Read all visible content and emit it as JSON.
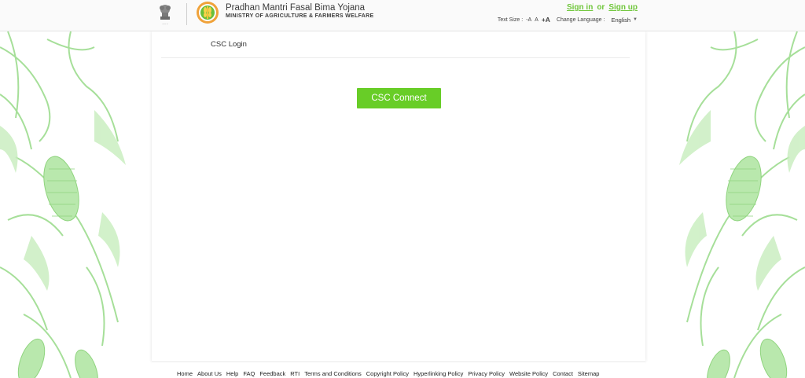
{
  "header": {
    "title": "Pradhan Mantri Fasal Bima Yojana",
    "subtitle": "MINISTRY OF AGRICULTURE & FARMERS WELFARE",
    "sign_in": "Sign in",
    "or": "or",
    "sign_up": "Sign up",
    "text_size_label": "Text Size :",
    "text_decrease": "-A",
    "text_normal": "A",
    "text_increase": "+A",
    "change_language_label": "Change Language :",
    "language_selected": "English"
  },
  "main": {
    "title": "CSC Login",
    "connect_button": "CSC Connect"
  },
  "footer": {
    "links": [
      "Home",
      "About Us",
      "Help",
      "FAQ",
      "Feedback",
      "RTI",
      "Terms and Conditions",
      "Copyright Policy",
      "Hyperlinking Policy",
      "Privacy Policy",
      "Website Policy",
      "Contact",
      "Sitemap"
    ]
  },
  "colors": {
    "accent_green": "#68cd27",
    "link_green": "#6fc63a",
    "decor_green": "#9ddc8f"
  },
  "icons": {
    "emblem": "national-emblem-icon",
    "logo": "pmfby-logo-icon",
    "language_dropdown": "chevron-down-icon"
  }
}
